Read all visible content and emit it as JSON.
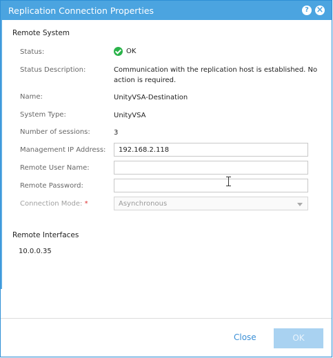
{
  "dialog": {
    "title": "Replication Connection Properties",
    "help_icon": "?",
    "close_icon": "×"
  },
  "remote_system": {
    "section_title": "Remote System",
    "status_label": "Status:",
    "status_value": "OK",
    "status_description_label": "Status Description:",
    "status_description_line1": "Communication with the replication host is established. No",
    "status_description_line2": "action is required.",
    "name_label": "Name:",
    "name_value": "UnityVSA-Destination",
    "system_type_label": "System Type:",
    "system_type_value": "UnityVSA",
    "sessions_label": "Number of sessions:",
    "sessions_value": "3",
    "mgmt_ip_label": "Management IP Address:",
    "mgmt_ip_value": "192.168.2.118",
    "remote_user_label": "Remote User Name:",
    "remote_user_value": "",
    "remote_password_label": "Remote Password:",
    "remote_password_value": "",
    "connection_mode_label": "Connection Mode:",
    "connection_mode_required": "*",
    "connection_mode_value": "Asynchronous"
  },
  "remote_interfaces": {
    "section_title": "Remote Interfaces",
    "items": [
      "10.0.0.35"
    ]
  },
  "footer": {
    "close_label": "Close",
    "ok_label": "OK"
  },
  "colors": {
    "title_bar": "#4ba4e0",
    "status_ok": "#2ab34a",
    "link": "#3a8fd6",
    "ok_button_disabled": "#a9d2f1"
  }
}
